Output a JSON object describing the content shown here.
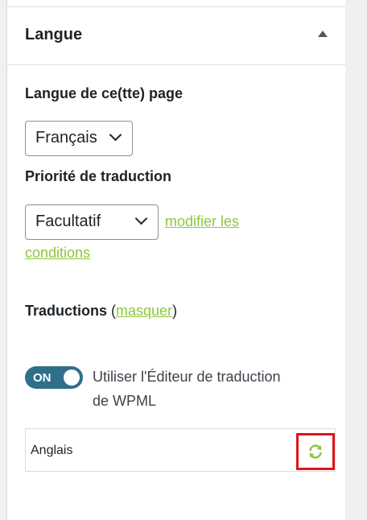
{
  "section": {
    "title": "Langue",
    "toggle_icon": "triangle-up-icon"
  },
  "language": {
    "label": "Langue de ce(tte) page",
    "selected": "Français"
  },
  "priority": {
    "label": "Priorité de traduction",
    "selected": "Facultatif",
    "link_part1": "modifier les",
    "link_part2": "conditions"
  },
  "translations": {
    "label": "Traductions",
    "paren_open": "(",
    "hide_link": "masquer",
    "paren_close": ")"
  },
  "editor": {
    "toggle_state": "ON",
    "label_line1": "Utiliser l'Éditeur de traduction",
    "label_line2": "de WPML"
  },
  "translation_rows": [
    {
      "language": "Anglais",
      "action_icon": "refresh-icon"
    }
  ],
  "colors": {
    "link": "#8dc63f",
    "toggle": "#2f6f8a",
    "highlight": "#e2141a"
  }
}
